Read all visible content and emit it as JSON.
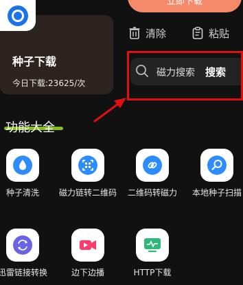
{
  "top_button": {
    "label": "立即下载"
  },
  "download_card": {
    "title": "种子下载",
    "today_label": "今日下载:23625/次"
  },
  "actions": {
    "clear": "清除",
    "paste": "粘贴"
  },
  "search": {
    "placeholder": "磁力搜索",
    "button": "搜索"
  },
  "section": {
    "title": "功能大全"
  },
  "features": [
    {
      "label": "种子清洗",
      "icon": "droplet-icon",
      "color": "#2f8cff"
    },
    {
      "label": "磁力链转二维码",
      "icon": "qr-scan-icon",
      "color": "#2f8cff"
    },
    {
      "label": "二维码转磁力",
      "icon": "link-icon",
      "color": "#2f8cff"
    },
    {
      "label": "本地种子扫描",
      "icon": "magnifier-icon",
      "color": "#2f8cff"
    },
    {
      "label": "迅雷链接转换",
      "icon": "convert-icon",
      "color": "#6a63e6"
    },
    {
      "label": "边下边播",
      "icon": "video-icon",
      "color": "#ff3b6b"
    },
    {
      "label": "HTTP下载",
      "icon": "monitor-icon",
      "color": "#2fb87a"
    }
  ],
  "colors": {
    "accent_orange": "#f58a6b",
    "highlight_red": "#e01010",
    "underline_green": "#8fd31d"
  }
}
